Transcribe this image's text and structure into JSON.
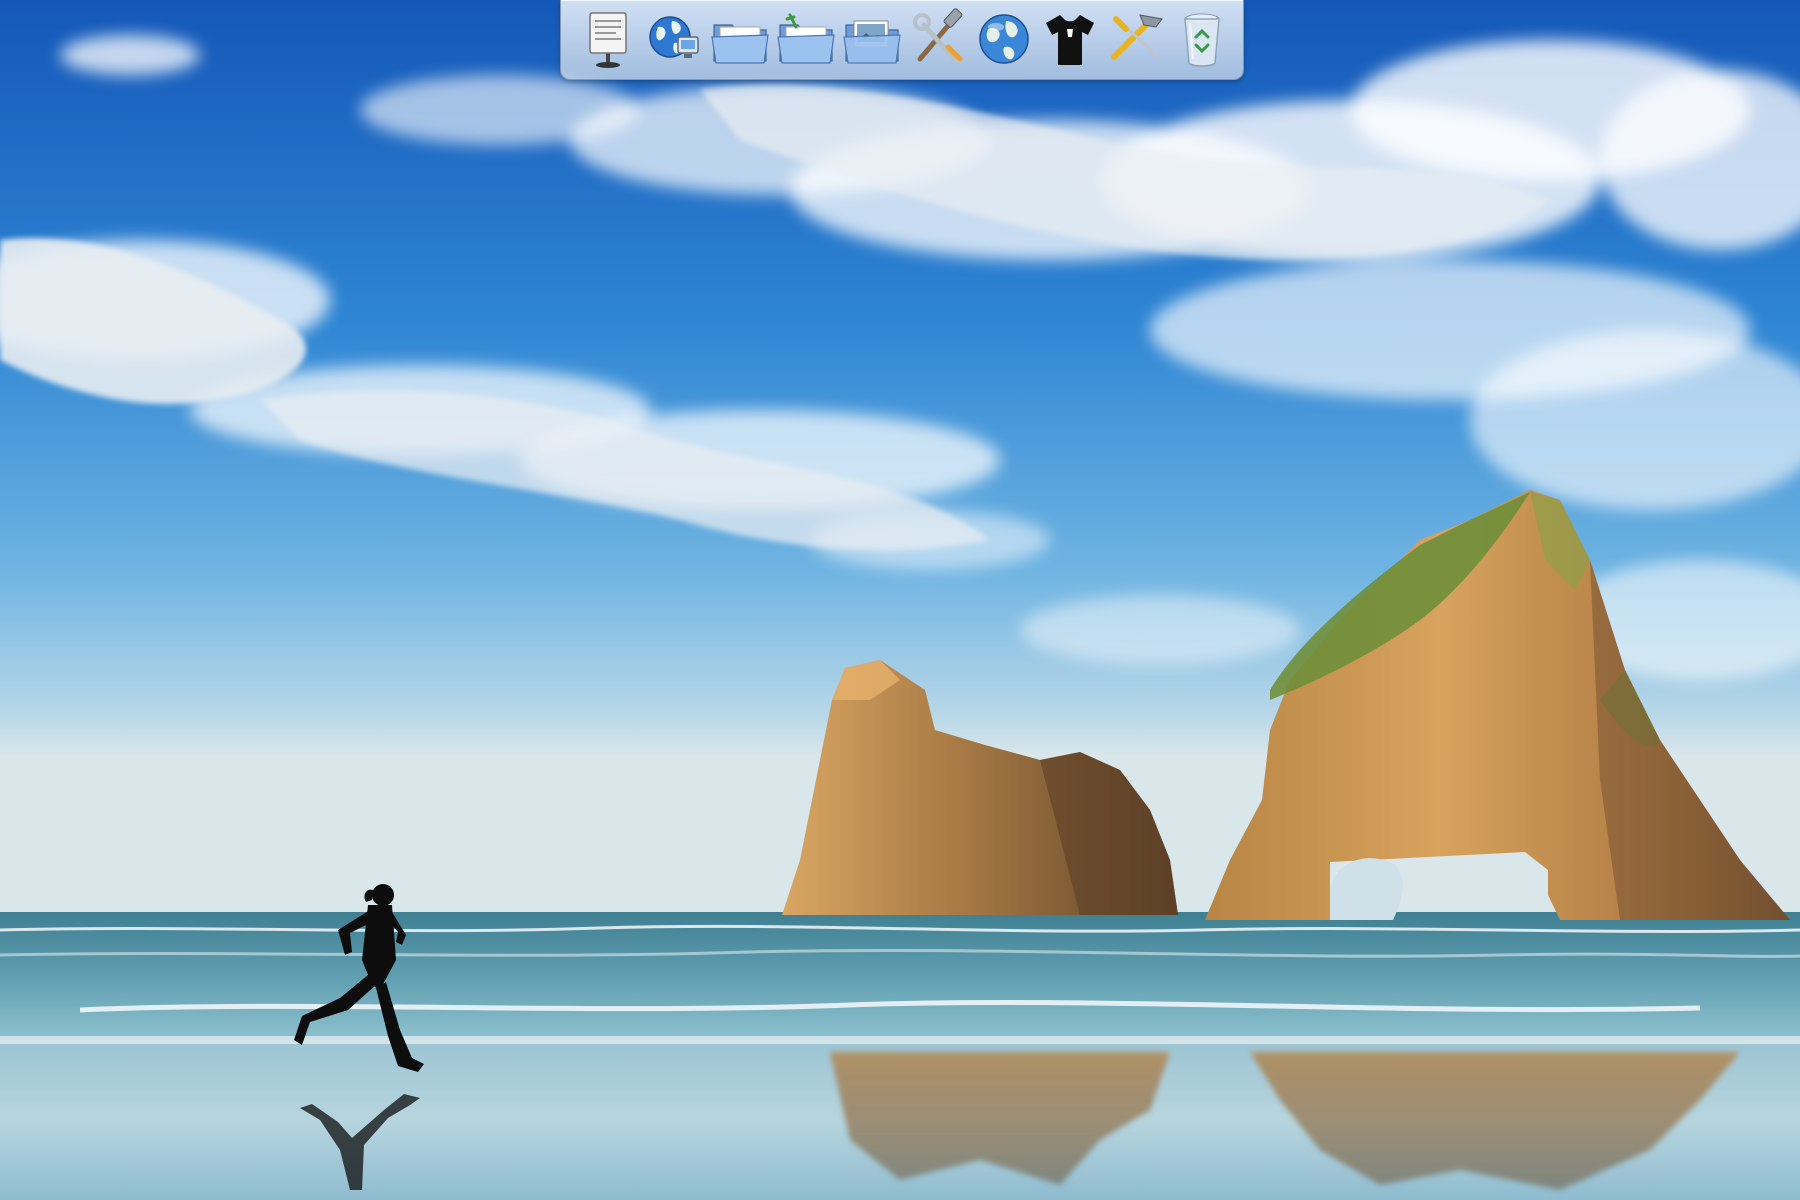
{
  "desktop": {
    "wallpaper": {
      "scene": "beach-with-sea-stacks",
      "colors": {
        "sky_top": "#1565c0",
        "sky_mid": "#3d8fd6",
        "horizon": "#cfe0e8",
        "sea": "#4d8fa3",
        "rock_lit": "#c99a5a",
        "rock_shadow": "#6d4d2f",
        "moss": "#6f8f3a",
        "sand": "#bcd6e2",
        "runner": "#111111"
      }
    },
    "dock": {
      "items": [
        {
          "name": "documents",
          "icon": "document-stand-icon"
        },
        {
          "name": "network",
          "icon": "globe-computer-icon"
        },
        {
          "name": "folder",
          "icon": "folder-icon"
        },
        {
          "name": "tools-folder",
          "icon": "folder-tools-icon"
        },
        {
          "name": "pictures-folder",
          "icon": "folder-pictures-icon"
        },
        {
          "name": "utilities",
          "icon": "hammer-wrench-icon"
        },
        {
          "name": "internet",
          "icon": "globe-icon"
        },
        {
          "name": "shirt",
          "icon": "tshirt-icon"
        },
        {
          "name": "settings",
          "icon": "hammer-screwdriver-icon"
        },
        {
          "name": "recycle-bin",
          "icon": "recycle-bin-icon"
        }
      ]
    }
  }
}
